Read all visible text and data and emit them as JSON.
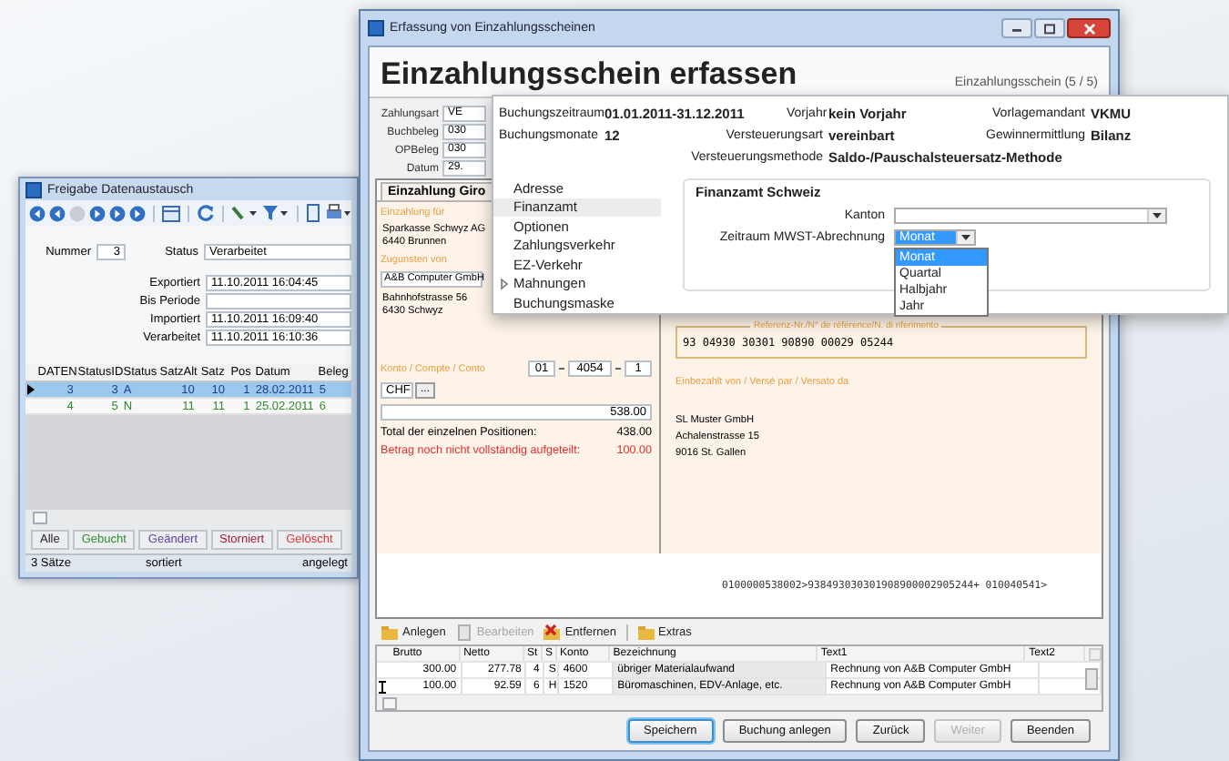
{
  "left_window": {
    "title": "Freigabe Datenaustausch",
    "number": {
      "label": "Nummer",
      "value": "3"
    },
    "status": {
      "label": "Status",
      "value": "Verarbeitet"
    },
    "fields": [
      {
        "label": "Exportiert",
        "value": "11.10.2011 16:04:45"
      },
      {
        "label": "Bis Periode"
      },
      {
        "label": "Importiert",
        "value": "11.10.2011 16:09:40"
      },
      {
        "label": "Verarbeitet",
        "value": "11.10.2011 16:10:36"
      }
    ],
    "table": {
      "columns": [
        "DATEN",
        "StatusID",
        "Status",
        "SatzAlt",
        "Satz",
        "Pos",
        "Datum",
        "Beleg"
      ],
      "rows": [
        {
          "cells": [
            "3",
            "3",
            "A",
            "10",
            "10",
            "1",
            "28.02.2011",
            "5"
          ],
          "selected": true
        },
        {
          "cells": [
            "4",
            "5",
            "N",
            "11",
            "11",
            "1",
            "25.02.2011",
            "6"
          ],
          "selected": false,
          "color": "#2e8b2e"
        }
      ]
    },
    "filters": [
      {
        "label": "Alle",
        "color": "#222222"
      },
      {
        "label": "Gebucht",
        "color": "#2e8b2e"
      },
      {
        "label": "Geändert",
        "color": "#5a3d9a"
      },
      {
        "label": "Storniert",
        "color": "#a02030"
      },
      {
        "label": "Gelöscht",
        "color": "#e03030"
      }
    ],
    "status_bar": [
      "3 Sätze",
      "sortiert",
      "angelegt"
    ]
  },
  "main_window": {
    "title": "Erfassung von Einzahlungsscheinen",
    "heading": "Einzahlungsschein erfassen",
    "counter": "Einzahlungsschein (5 / 5)",
    "header_fields": [
      {
        "label": "Zahlungsart",
        "value": "VE"
      },
      {
        "label": "Buchbeleg",
        "value": "030"
      },
      {
        "label": "OPBeleg",
        "value": "030"
      },
      {
        "label": "Datum",
        "value": "29."
      }
    ],
    "slip": {
      "tab": "Einzahlung Giro",
      "label_for": "Einzahlung für",
      "bank": [
        "Sparkasse Schwyz AG",
        "6440 Brunnen"
      ],
      "label_favor": "Zugunsten von",
      "beneficiary": "A&B Computer GmbH",
      "beneficiary_address": [
        "Bahnhofstrasse 56",
        "6430 Schwyz"
      ],
      "account_label": "Konto / Compte / Conto",
      "account": [
        "01",
        "4054",
        "1"
      ],
      "currency": "CHF",
      "currency_button": "...",
      "amount": "538.00",
      "total_label": "Total der einzelnen Positionen:",
      "total": "438.00",
      "open_label": "Betrag noch nicht vollständig aufgeteilt:",
      "open": "100.00",
      "reference_label": "Referenz-Nr./N° de référence/N. di riferimento",
      "reference": "93 04930 30301 90890 00029 05244",
      "payer_label": "Einbezahlt von / Versé par / Versato da",
      "payer": [
        "SL Muster GmbH",
        "Achalenstrasse 15",
        "9016 St. Gallen"
      ],
      "codeline": "0100000538002>938493030301908900002905244+ 010040541>"
    },
    "toolbar": [
      {
        "label": "Anlegen",
        "disabled": false
      },
      {
        "label": "Bearbeiten",
        "disabled": true
      },
      {
        "label": "Entfernen",
        "disabled": false
      },
      {
        "label": "Extras",
        "disabled": false
      }
    ],
    "table": {
      "columns": [
        "Brutto",
        "Netto",
        "St",
        "S",
        "Konto",
        "Bezeichnung",
        "Text1",
        "Text2"
      ],
      "rows": [
        {
          "cells": [
            "300.00",
            "277.78",
            "4",
            "S",
            "4600",
            "übriger Materialaufwand",
            "Rechnung von A&B Computer GmbH"
          ],
          "current": false
        },
        {
          "cells": [
            "100.00",
            "92.59",
            "6",
            "H",
            "1520",
            "Büromaschinen, EDV-Anlage, etc.",
            "Rechnung von A&B Computer GmbH"
          ],
          "current": true
        }
      ]
    },
    "buttons": [
      {
        "label": "Speichern",
        "focused": true,
        "disabled": false
      },
      {
        "label": "Buchung anlegen",
        "focused": false,
        "disabled": false
      },
      {
        "label": "Zurück",
        "focused": false,
        "disabled": false
      },
      {
        "label": "Weiter",
        "focused": false,
        "disabled": true
      },
      {
        "label": "Beenden",
        "focused": false,
        "disabled": false
      }
    ]
  },
  "settings_panel": {
    "info": [
      [
        {
          "label": "Buchungszeitraum",
          "value": "01.01.2011-31.12.2011"
        },
        {
          "label": "Vorjahr",
          "value": "kein Vorjahr"
        },
        {
          "label": "Vorlagemandant",
          "value": "VKMU"
        }
      ],
      [
        {
          "label": "Buchungsmonate",
          "value": "12"
        },
        {
          "label": "Versteuerungsart",
          "value": "vereinbart"
        },
        {
          "label": "Gewinnermittlung",
          "value": "Bilanz"
        }
      ],
      [
        {
          "label": "Versteuerungsmethode",
          "value": "Saldo-/Pauschalsteuersatz-Methode"
        }
      ]
    ],
    "nav": [
      {
        "label": "Adresse",
        "selected": false,
        "expandable": false
      },
      {
        "label": "Finanzamt",
        "selected": true,
        "expandable": false
      },
      {
        "label": "Optionen",
        "selected": false,
        "expandable": false
      },
      {
        "label": "Zahlungsverkehr",
        "selected": false,
        "expandable": false
      },
      {
        "label": "EZ-Verkehr",
        "selected": false,
        "expandable": false
      },
      {
        "label": "Mahnungen",
        "selected": false,
        "expandable": true
      },
      {
        "label": "Buchungsmaske",
        "selected": false,
        "expandable": false
      }
    ],
    "section_title": "Finanzamt Schweiz",
    "canton_label": "Kanton",
    "period_label": "Zeitraum MWST-Abrechnung",
    "period_value": "Monat",
    "period_options": [
      {
        "label": "Monat",
        "selected": true
      },
      {
        "label": "Quartal",
        "selected": false
      },
      {
        "label": "Halbjahr",
        "selected": false
      },
      {
        "label": "Jahr",
        "selected": false
      }
    ]
  }
}
